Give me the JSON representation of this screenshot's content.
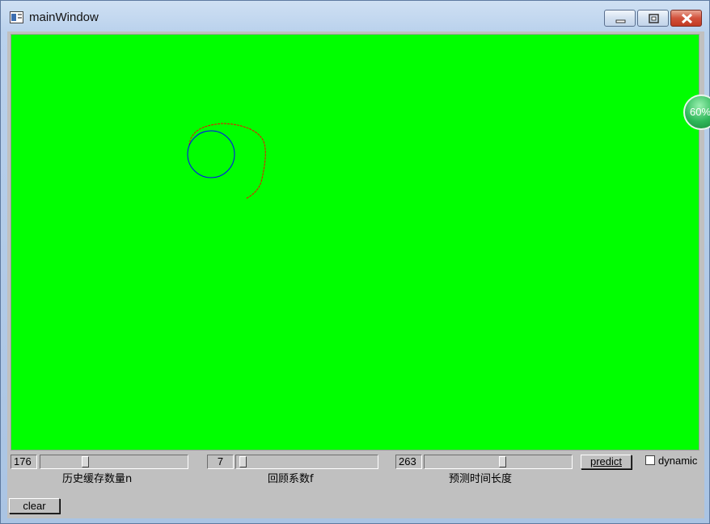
{
  "window": {
    "title": "mainWindow"
  },
  "controls": {
    "history": {
      "value": "176",
      "label": "历史缓存数量n",
      "level": 0.29
    },
    "review": {
      "value": "7",
      "label": "回顾系数f",
      "level": 0.02
    },
    "forecast": {
      "value": "263",
      "label": "预测时间长度",
      "level": 0.53
    },
    "predict_label": "predict",
    "dynamic_label": "dynamic",
    "dynamic_checked": false,
    "clear_label": "clear"
  },
  "overlay": {
    "badge_text": "60%"
  },
  "colors": {
    "canvas": "#00ff00",
    "trace": "#ff0000",
    "circle": "#0000ff"
  }
}
